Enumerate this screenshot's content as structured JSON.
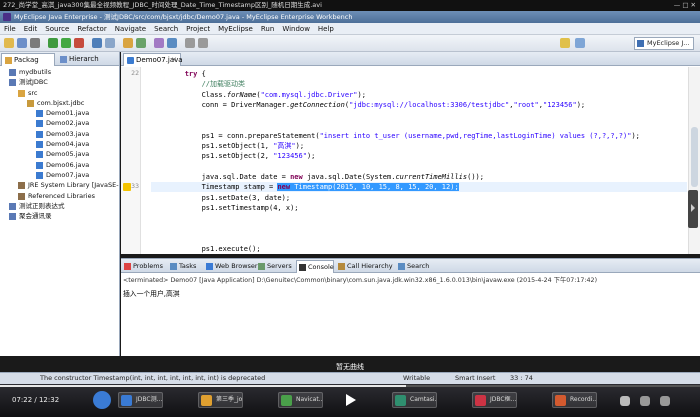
{
  "video": {
    "title": "272_尚学堂_高淇_java300集最全视频教程_JDBC_时间处理_Date_Time_Timestamp区别_随机日期生成.avi",
    "time": "07:22 / 12:32",
    "overlay": "暂无曲线",
    "progress": 0.58,
    "tasks": [
      "JDBC测...",
      "第三季_jo...",
      "Navicat...",
      "Camtasi...",
      "JDBC框...",
      "Recordi..."
    ]
  },
  "window": {
    "title": "MyEclipse Java Enterprise - 测试JDBC/src/com/bjsxt/jdbc/Demo07.java - MyEclipse Enterprise Workbench"
  },
  "menu": [
    "File",
    "Edit",
    "Source",
    "Refactor",
    "Navigate",
    "Search",
    "Project",
    "MyEclipse",
    "Run",
    "Window",
    "Help"
  ],
  "toolbar": {
    "perspective": "MyEclipse J..."
  },
  "explorer": {
    "tabs": [
      "Packag",
      "Hierarch"
    ],
    "items": [
      {
        "label": "mydbutils",
        "indent": 1,
        "icon": "project"
      },
      {
        "label": "测试JDBC",
        "indent": 1,
        "icon": "project"
      },
      {
        "label": "src",
        "indent": 2,
        "icon": "folder"
      },
      {
        "label": "com.bjsxt.jdbc",
        "indent": 3,
        "icon": "package"
      },
      {
        "label": "Demo01.java",
        "indent": 4,
        "icon": "java"
      },
      {
        "label": "Demo02.java",
        "indent": 4,
        "icon": "java"
      },
      {
        "label": "Demo03.java",
        "indent": 4,
        "icon": "java"
      },
      {
        "label": "Demo04.java",
        "indent": 4,
        "icon": "java"
      },
      {
        "label": "Demo05.java",
        "indent": 4,
        "icon": "java"
      },
      {
        "label": "Demo06.java",
        "indent": 4,
        "icon": "java"
      },
      {
        "label": "Demo07.java",
        "indent": 4,
        "icon": "java"
      },
      {
        "label": "JRE System Library [JavaSE-",
        "indent": 2,
        "icon": "library"
      },
      {
        "label": "Referenced Libraries",
        "indent": 2,
        "icon": "library"
      },
      {
        "label": "测试正则表达式",
        "indent": 1,
        "icon": "project"
      },
      {
        "label": "聚会通讯录",
        "indent": 1,
        "icon": "project"
      }
    ]
  },
  "editor": {
    "tab": "Demo07.java",
    "lines": [
      {
        "n": "22",
        "html": "        <span class='kw'>try</span> {"
      },
      {
        "n": "",
        "html": "            <span class='cm'>//加载驱动类</span>"
      },
      {
        "n": "",
        "html": "            Class.<span class='it'>forName</span>(<span class='str'>\"com.mysql.jdbc.Driver\"</span>);"
      },
      {
        "n": "",
        "html": "            conn = DriverManager.<span class='it'>getConnection</span>(<span class='str'>\"jdbc:mysql://localhost:3306/testjdbc\"</span>,<span class='str'>\"root\"</span>,<span class='str'>\"123456\"</span>);"
      },
      {
        "n": "",
        "html": ""
      },
      {
        "n": "",
        "html": ""
      },
      {
        "n": "",
        "html": "            ps1 = conn.prepareStatement(<span class='str'>\"insert into t_user (username,pwd,regTime,lastLoginTime) values (?,?,?,?)\"</span>);"
      },
      {
        "n": "",
        "html": "            ps1.setObject(1, <span class='str'>\"高淇\"</span>);"
      },
      {
        "n": "",
        "html": "            ps1.setObject(2, <span class='str'>\"123456\"</span>);"
      },
      {
        "n": "",
        "html": ""
      },
      {
        "n": "",
        "html": "            java.sql.Date date = <span class='kw'>new</span> java.sql.Date(System.<span class='it'>currentTimeMillis</span>());"
      },
      {
        "n": "33",
        "html": "            Timestamp stamp = <span class='sel'><span class='kw'>new</span> Timestamp(2015, 10, 15, 8, 15, 20, 12);</span>",
        "hl": true,
        "warn": true
      },
      {
        "n": "",
        "html": "            ps1.setDate(3, date);"
      },
      {
        "n": "",
        "html": "            ps1.setTimestamp(4, x);"
      },
      {
        "n": "",
        "html": ""
      },
      {
        "n": "",
        "html": ""
      },
      {
        "n": "",
        "html": ""
      },
      {
        "n": "",
        "html": "            ps1.execute();"
      }
    ]
  },
  "console": {
    "tabs": [
      "Problems",
      "Tasks",
      "Web Browser",
      "Servers",
      "Console",
      "Call Hierarchy",
      "Search"
    ],
    "terminated": "<terminated> Demo07 [Java Application] D:\\Genuitec\\Common\\binary\\com.sun.java.jdk.win32.x86_1.6.0.013\\bin\\javaw.exe (2015-4-24 下午07:17:42)",
    "output": "插入一个用户,高淇"
  },
  "status": {
    "message": "The constructor Timestamp(int, int, int, int, int, int, int) is deprecated",
    "writable": "Writable",
    "mode": "Smart Insert",
    "pos": "33 : 74"
  },
  "colors": {
    "keyword": "#7f0055",
    "string": "#2a00ff",
    "comment": "#3f7f5f",
    "selection": "#3399ff"
  }
}
